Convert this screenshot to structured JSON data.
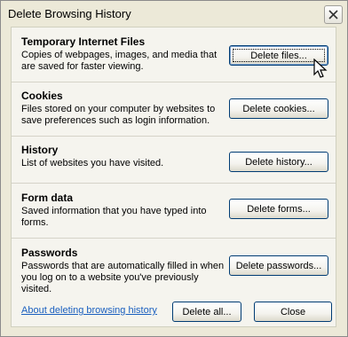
{
  "window": {
    "title": "Delete Browsing History"
  },
  "sections": [
    {
      "title": "Temporary Internet Files",
      "desc": [
        "Copies of webpages, images, and media that",
        "are saved for faster viewing."
      ],
      "button": "Delete files..."
    },
    {
      "title": "Cookies",
      "desc": [
        "Files stored on your computer by websites to",
        "save preferences such as login information."
      ],
      "button": "Delete cookies..."
    },
    {
      "title": "History",
      "desc": [
        "List of websites you have visited."
      ],
      "button": "Delete history..."
    },
    {
      "title": "Form data",
      "desc": [
        "Saved information that you have typed into",
        "forms."
      ],
      "button": "Delete forms..."
    },
    {
      "title": "Passwords",
      "desc": [
        "Passwords that are automatically filled in when",
        "you log on to a website you've previously",
        "visited."
      ],
      "button": "Delete passwords..."
    }
  ],
  "footer": {
    "link": "About deleting browsing history",
    "delete_all": "Delete all...",
    "close": "Close"
  },
  "icons": {
    "close": "close-icon",
    "cursor": "mouse-pointer-icon"
  }
}
